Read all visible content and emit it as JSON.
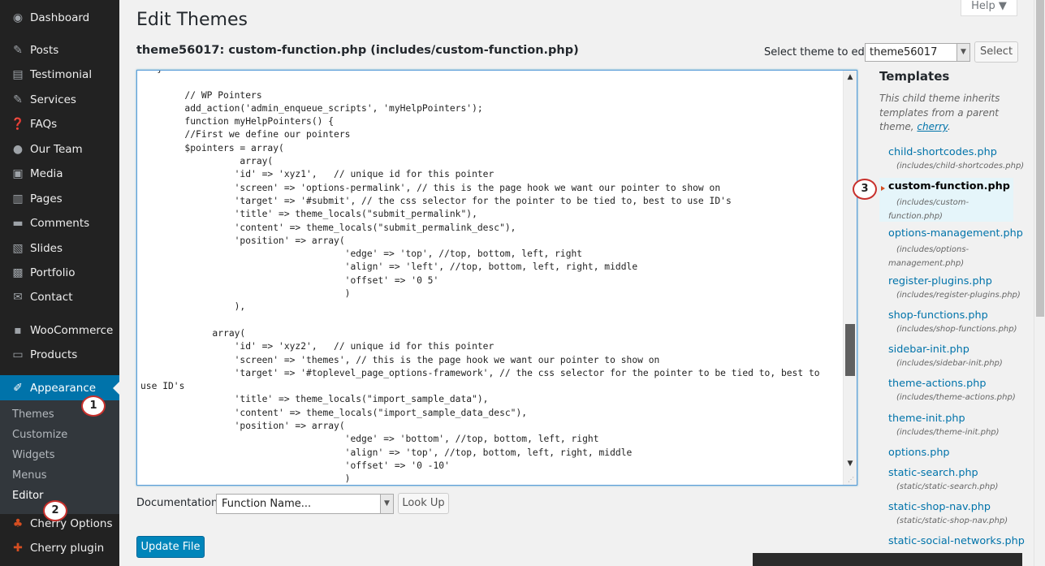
{
  "sidebar": {
    "items": [
      {
        "icon": "dashboard-icon",
        "glyph": "◉",
        "label": "Dashboard"
      },
      {
        "icon": "pin-icon",
        "glyph": "✎",
        "label": "Posts"
      },
      {
        "icon": "comment-icon",
        "glyph": "▤",
        "label": "Testimonial"
      },
      {
        "icon": "pin-icon",
        "glyph": "✎",
        "label": "Services"
      },
      {
        "icon": "help-icon",
        "glyph": "❓",
        "label": "FAQs"
      },
      {
        "icon": "user-icon",
        "glyph": "●",
        "label": "Our Team"
      },
      {
        "icon": "media-icon",
        "glyph": "▣",
        "label": "Media"
      },
      {
        "icon": "pages-icon",
        "glyph": "▥",
        "label": "Pages"
      },
      {
        "icon": "comments-icon",
        "glyph": "▬",
        "label": "Comments"
      },
      {
        "icon": "slides-icon",
        "glyph": "▧",
        "label": "Slides"
      },
      {
        "icon": "portfolio-icon",
        "glyph": "▩",
        "label": "Portfolio"
      },
      {
        "icon": "mail-icon",
        "glyph": "✉",
        "label": "Contact"
      },
      {
        "icon": "woocommerce-icon",
        "glyph": "▪",
        "label": "WooCommerce"
      },
      {
        "icon": "cart-icon",
        "glyph": "▭",
        "label": "Products"
      },
      {
        "icon": "brush-icon",
        "glyph": "✐",
        "label": "Appearance"
      }
    ],
    "submenu": [
      "Themes",
      "Customize",
      "Widgets",
      "Menus",
      "Editor"
    ],
    "extra": [
      {
        "icon": "cherry-icon",
        "glyph": "♣",
        "label": "Cherry Options"
      },
      {
        "icon": "plugin-icon",
        "glyph": "✚",
        "label": "Cherry plugin"
      }
    ]
  },
  "header": {
    "title": "Edit Themes",
    "file_title": "theme56017: custom-function.php (includes/custom-function.php)",
    "help": "Help ▼",
    "select_label": "Select theme to edit:",
    "selected_theme": "theme56017",
    "select_button": "Select"
  },
  "editor": {
    "lines": [
      "   }",
      "",
      "        // WP Pointers",
      "        add_action('admin_enqueue_scripts', 'myHelpPointers');",
      "        function myHelpPointers() {",
      "        //First we define our pointers",
      "        $pointers = array(",
      "                  array(",
      "                 'id' => 'xyz1',   // unique id for this pointer",
      "                 'screen' => 'options-permalink', // this is the page hook we want our pointer to show on",
      "                 'target' => '#submit', // the css selector for the pointer to be tied to, best to use ID's",
      "                 'title' => theme_locals(\"submit_permalink\"),",
      "                 'content' => theme_locals(\"submit_permalink_desc\"),",
      "                 'position' => array(",
      "                                     'edge' => 'top', //top, bottom, left, right",
      "                                     'align' => 'left', //top, bottom, left, right, middle",
      "                                     'offset' => '0 5'",
      "                                     )",
      "                 ),",
      "",
      "             array(",
      "                 'id' => 'xyz2',   // unique id for this pointer",
      "                 'screen' => 'themes', // this is the page hook we want our pointer to show on",
      "                 'target' => '#toplevel_page_options-framework', // the css selector for the pointer to be tied to, best to",
      "use ID's",
      "                 'title' => theme_locals(\"import_sample_data\"),",
      "                 'content' => theme_locals(\"import_sample_data_desc\"),",
      "                 'position' => array(",
      "                                     'edge' => 'bottom', //top, bottom, left, right",
      "                                     'align' => 'top', //top, bottom, left, right, middle",
      "                                     'offset' => '0 -10'",
      "                                     )"
    ]
  },
  "templates": {
    "heading": "Templates",
    "note": "This child theme inherits templates from a parent theme,",
    "parent_link": "cherry",
    "files": [
      {
        "name": "child-shortcodes.php",
        "path": "(includes/child-shortcodes.php)"
      },
      {
        "name": "custom-function.php",
        "path": "(includes/custom-function.php)"
      },
      {
        "name": "options-management.php",
        "path": "(includes/options-management.php)"
      },
      {
        "name": "register-plugins.php",
        "path": "(includes/register-plugins.php)"
      },
      {
        "name": "shop-functions.php",
        "path": "(includes/shop-functions.php)"
      },
      {
        "name": "sidebar-init.php",
        "path": "(includes/sidebar-init.php)"
      },
      {
        "name": "theme-actions.php",
        "path": "(includes/theme-actions.php)"
      },
      {
        "name": "theme-init.php",
        "path": "(includes/theme-init.php)"
      },
      {
        "name": "options.php",
        "path": ""
      },
      {
        "name": "static-search.php",
        "path": "(static/static-search.php)"
      },
      {
        "name": "static-shop-nav.php",
        "path": "(static/static-shop-nav.php)"
      },
      {
        "name": "static-social-networks.php",
        "path": ""
      }
    ]
  },
  "documentation": {
    "label": "Documentation:",
    "placeholder": "Function Name...",
    "lookup": "Look Up"
  },
  "update_button": "Update File",
  "callouts": [
    "1",
    "2",
    "3"
  ],
  "colors": {
    "accent": "#0073aa",
    "sidebar": "#222222",
    "callout": "#c8302c"
  }
}
